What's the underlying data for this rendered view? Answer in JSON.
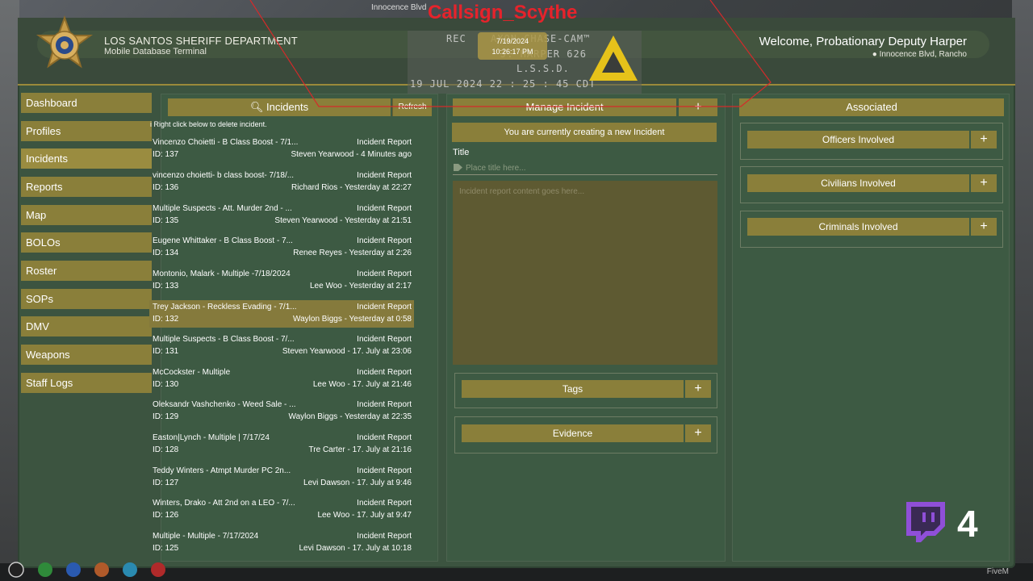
{
  "overlay": {
    "callsign": "Callsign_Scythe",
    "top_text": "Innocence Blvd",
    "cam_rec": "REC",
    "cam_line1": "AXON CHASE-CAM™",
    "cam_line2": "J. HARPER 626",
    "cam_line3": "L.S.S.D.",
    "cam_line4": "19 JUL 2024  22 : 25 : 45 CDT",
    "rec_date": "7/19/2024",
    "rec_time": "10:26:17 PM",
    "stream_count": "4",
    "watermark": "FiveM"
  },
  "header": {
    "dept_name": "LOS SANTOS SHERIFF DEPARTMENT",
    "dept_sub": "Mobile Database Terminal",
    "welcome": "Welcome, Probationary Deputy Harper",
    "location": "Innocence Blvd, Rancho"
  },
  "sidebar": {
    "items": [
      {
        "label": "Dashboard"
      },
      {
        "label": "Profiles"
      },
      {
        "label": "Incidents"
      },
      {
        "label": "Reports"
      },
      {
        "label": "Map"
      },
      {
        "label": "BOLOs"
      },
      {
        "label": "Roster"
      },
      {
        "label": "SOPs"
      },
      {
        "label": "DMV"
      },
      {
        "label": "Weapons"
      },
      {
        "label": "Staff Logs"
      }
    ]
  },
  "incidents": {
    "title": "Incidents",
    "refresh_label": "Refresh",
    "hint": "Right click below to delete incident.",
    "rows": [
      {
        "title": "Vincenzo Choietti - B Class Boost - 7/1...",
        "type": "Incident Report",
        "id": "ID: 137",
        "meta": "Steven Yearwood - 4 Minutes ago"
      },
      {
        "title": "vincenzo choietti- b class boost- 7/18/...",
        "type": "Incident Report",
        "id": "ID: 136",
        "meta": "Richard Rios - Yesterday at 22:27"
      },
      {
        "title": "Multiple Suspects - Att. Murder 2nd - ...",
        "type": "Incident Report",
        "id": "ID: 135",
        "meta": "Steven Yearwood - Yesterday at 21:51"
      },
      {
        "title": "Eugene Whittaker - B Class Boost - 7...",
        "type": "Incident Report",
        "id": "ID: 134",
        "meta": "Renee Reyes - Yesterday at 2:26"
      },
      {
        "title": "Montonio, Malark - Multiple -7/18/2024",
        "type": "Incident Report",
        "id": "ID: 133",
        "meta": "Lee Woo - Yesterday at 2:17"
      },
      {
        "title": "Trey Jackson - Reckless Evading - 7/1...",
        "type": "Incident Report",
        "id": "ID: 132",
        "meta": "Waylon Biggs - Yesterday at 0:58"
      },
      {
        "title": "Multiple Suspects - B Class Boost - 7/...",
        "type": "Incident Report",
        "id": "ID: 131",
        "meta": "Steven Yearwood - 17. July at 23:06"
      },
      {
        "title": "McCockster - Multiple",
        "type": "Incident Report",
        "id": "ID: 130",
        "meta": "Lee Woo - 17. July at 21:46"
      },
      {
        "title": "Oleksandr Vashchenko - Weed Sale - ...",
        "type": "Incident Report",
        "id": "ID: 129",
        "meta": "Waylon Biggs - Yesterday at 22:35"
      },
      {
        "title": "Easton|Lynch - Multiple | 7/17/24",
        "type": "Incident Report",
        "id": "ID: 128",
        "meta": "Tre Carter - 17. July at 21:16"
      },
      {
        "title": "Teddy Winters - Atmpt Murder PC 2n...",
        "type": "Incident Report",
        "id": "ID: 127",
        "meta": "Levi Dawson - 17. July at 9:46"
      },
      {
        "title": "Winters, Drako - Att 2nd on a LEO - 7/...",
        "type": "Incident Report",
        "id": "ID: 126",
        "meta": "Lee Woo - 17. July at 9:47"
      },
      {
        "title": "Multiple - Multiple - 7/17/2024",
        "type": "Incident Report",
        "id": "ID: 125",
        "meta": "Levi Dawson - 17. July at 10:18"
      }
    ]
  },
  "manage": {
    "title": "Manage Incident",
    "add_label": "+",
    "creating_notice": "You are currently creating a new Incident",
    "title_label": "Title",
    "title_placeholder": "Place title here...",
    "content_placeholder": "Incident report content goes here...",
    "tags_label": "Tags",
    "evidence_label": "Evidence",
    "plus": "+"
  },
  "associated": {
    "title": "Associated",
    "officers_label": "Officers Involved",
    "civilians_label": "Civilians Involved",
    "criminals_label": "Criminals Involved",
    "plus": "+"
  },
  "colors": {
    "panel_green": "#3d5a43",
    "gold": "#8a7f3a",
    "accent_red": "#e6232b"
  }
}
